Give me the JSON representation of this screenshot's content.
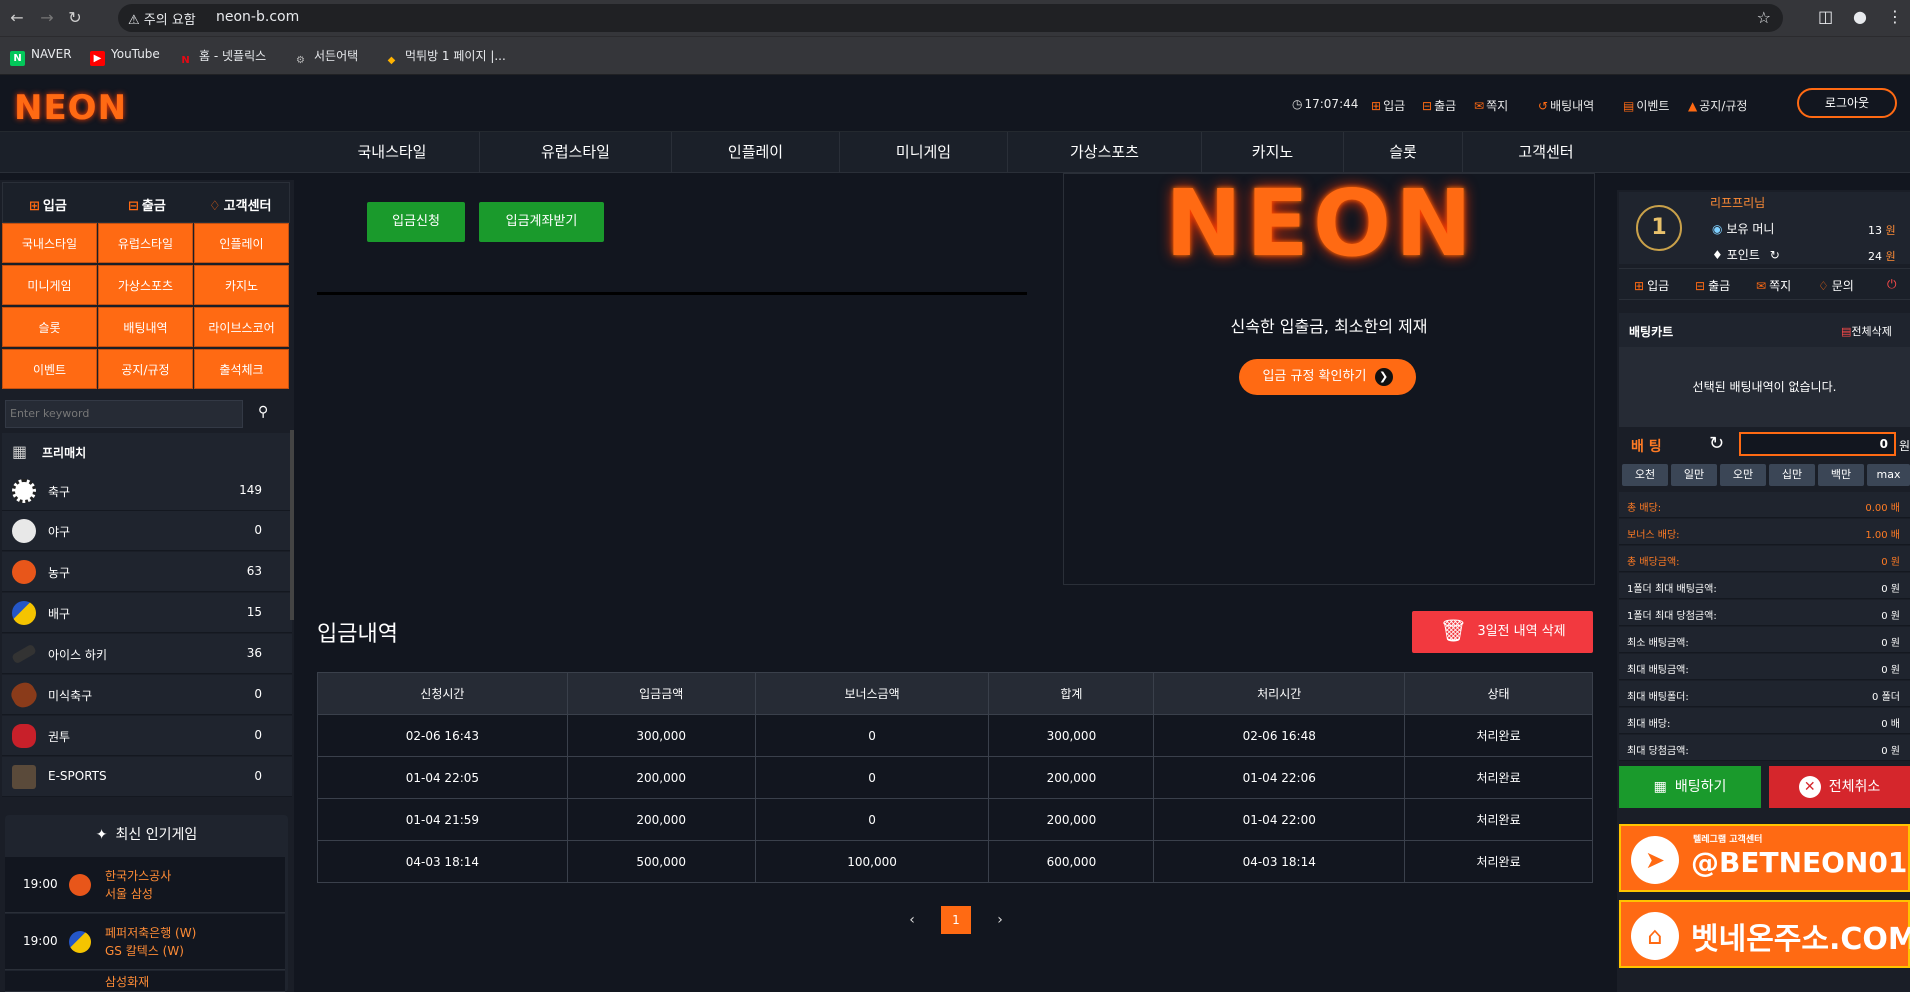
{
  "browser": {
    "warning": "주의 요함",
    "url": "neon-b.com",
    "bookmarks": [
      "NAVER",
      "YouTube",
      "홈 - 넷플릭스",
      "서든어택",
      "먹튀방 1 페이지 |..."
    ]
  },
  "header": {
    "logo": "NEON",
    "time": "17:07:44",
    "links": [
      "입금",
      "출금",
      "쪽지",
      "배팅내역",
      "이벤트",
      "공지/규정"
    ],
    "logout": "로그아웃"
  },
  "mainnav": [
    "국내스타일",
    "유럽스타일",
    "인플레이",
    "미니게임",
    "가상스포츠",
    "카지노",
    "슬롯",
    "고객센터"
  ],
  "sidebar": {
    "quick": [
      "입금",
      "출금",
      "고객센터"
    ],
    "grid": [
      "국내스타일",
      "유럽스타일",
      "인플레이",
      "미니게임",
      "가상스포츠",
      "카지노",
      "슬롯",
      "배팅내역",
      "라이브스코어",
      "이벤트",
      "공지/규정",
      "출석체크"
    ],
    "search_placeholder": "Enter keyword",
    "prematch": "프리매치",
    "sports": [
      {
        "name": "축구",
        "count": "149"
      },
      {
        "name": "야구",
        "count": "0"
      },
      {
        "name": "농구",
        "count": "63"
      },
      {
        "name": "배구",
        "count": "15"
      },
      {
        "name": "아이스 하키",
        "count": "36"
      },
      {
        "name": "미식축구",
        "count": "0"
      },
      {
        "name": "권투",
        "count": "0"
      },
      {
        "name": "E-SPORTS",
        "count": "0"
      }
    ],
    "popular_title": "최신 인기게임",
    "popular": [
      {
        "time": "19:00",
        "team1": "한국가스공사",
        "team2": "서울 삼성"
      },
      {
        "time": "19:00",
        "team1": "페퍼저축은행 (W)",
        "team2": "GS 칼텍스 (W)"
      },
      {
        "time": "",
        "team1": "삼성화재",
        "team2": ""
      }
    ]
  },
  "center": {
    "apply_btn": "입금신청",
    "account_btn": "입금계좌받기",
    "promo_logo": "NEON",
    "promo_text": "신속한 입출금, 최소한의 제재",
    "promo_btn": "입금 규정 확인하기",
    "history_title": "입금내역",
    "delete_btn": "3일전 내역 삭제",
    "columns": [
      "신청시간",
      "입금금액",
      "보너스금액",
      "합계",
      "처리시간",
      "상태"
    ],
    "rows": [
      [
        "02-06 16:43",
        "300,000",
        "0",
        "300,000",
        "02-06 16:48",
        "처리완료"
      ],
      [
        "01-04 22:05",
        "200,000",
        "0",
        "200,000",
        "01-04 22:06",
        "처리완료"
      ],
      [
        "01-04 21:59",
        "200,000",
        "0",
        "200,000",
        "01-04 22:00",
        "처리완료"
      ],
      [
        "04-03 18:14",
        "500,000",
        "100,000",
        "600,000",
        "04-03 18:14",
        "처리완료"
      ]
    ],
    "page": "1"
  },
  "right": {
    "rank": "1",
    "username": "리프프리님",
    "money_label": "보유 머니",
    "money_value": "13",
    "point_label": "포인트",
    "point_value": "24",
    "won": "원",
    "actions": [
      "입금",
      "출금",
      "쪽지",
      "문의"
    ],
    "cart_title": "배팅카트",
    "cart_clear": "전체삭제",
    "cart_empty": "선택된 배팅내역이 없습니다.",
    "bet_label": "배 팅",
    "bet_value": "0",
    "bet_unit": "원",
    "chips": [
      "오천",
      "일만",
      "오만",
      "십만",
      "백만",
      "max"
    ],
    "stats": [
      {
        "label": "총 배당:",
        "value": "0.00 배",
        "highlight": true
      },
      {
        "label": "보너스 배당:",
        "value": "1.00 배",
        "highlight": true
      },
      {
        "label": "총 배당금액:",
        "value": "0 원",
        "highlight": true
      },
      {
        "label": "1폴더 최대 배팅금액:",
        "value": "0 원",
        "highlight": false
      },
      {
        "label": "1폴더 최대 당첨금액:",
        "value": "0 원",
        "highlight": false
      },
      {
        "label": "최소 배팅금액:",
        "value": "0 원",
        "highlight": false
      },
      {
        "label": "최대 배팅금액:",
        "value": "0 원",
        "highlight": false
      },
      {
        "label": "최대 배팅폴더:",
        "value": "0 폴더",
        "highlight": false
      },
      {
        "label": "최대 배당:",
        "value": "0 배",
        "highlight": false
      },
      {
        "label": "최대 당첨금액:",
        "value": "0 원",
        "highlight": false
      }
    ],
    "place_btn": "배팅하기",
    "cancel_btn": "전체취소",
    "banner1_small": "텔레그램 고객센터",
    "banner1_big": "@BETNEON01",
    "banner2_big": "벳네온주소.COM"
  },
  "colors": {
    "accent": "#ff6a13",
    "green": "#1a9a2c",
    "red": "#f2393f",
    "bg": "#12161f"
  }
}
